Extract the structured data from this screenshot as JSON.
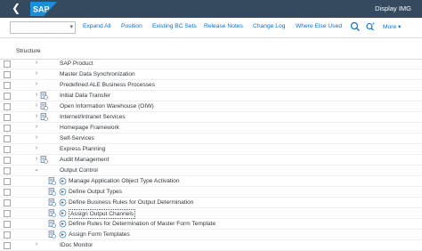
{
  "shell": {
    "title": "Display IMG",
    "logo_text": "SAP"
  },
  "toolbar": {
    "select_value": "",
    "buttons": [
      "Expand All",
      "Position",
      "Existing BC Sets",
      "Release Notes",
      "Change Log",
      "Where Else Used"
    ],
    "more": "More"
  },
  "structure": {
    "header": "Structure",
    "rows": [
      {
        "label": "SAP Product",
        "level": 0,
        "expanded": false,
        "icons": []
      },
      {
        "label": "Master Data Synchronization",
        "level": 0,
        "expanded": false,
        "icons": []
      },
      {
        "label": "Predefined ALE Business Processes",
        "level": 0,
        "expanded": false,
        "icons": []
      },
      {
        "label": "Initial Data Transfer",
        "level": 0,
        "expanded": false,
        "icons": [
          "doc-icon"
        ]
      },
      {
        "label": "Open Information Warehouse (OIW)",
        "level": 0,
        "expanded": false,
        "icons": [
          "doc-icon"
        ]
      },
      {
        "label": "Internet/Intranet Services",
        "level": 0,
        "expanded": false,
        "icons": [
          "doc-icon"
        ]
      },
      {
        "label": "Homepage Framework",
        "level": 0,
        "expanded": false,
        "icons": []
      },
      {
        "label": "Self-Services",
        "level": 0,
        "expanded": false,
        "icons": []
      },
      {
        "label": "Express Planning",
        "level": 0,
        "expanded": false,
        "icons": []
      },
      {
        "label": "Audit Management",
        "level": 0,
        "expanded": false,
        "icons": [
          "doc-icon"
        ]
      },
      {
        "label": "Output Control",
        "level": 0,
        "expanded": true,
        "icons": []
      },
      {
        "label": "Manage Application Object Type Activation",
        "level": 1,
        "leaf": true,
        "icons": [
          "doc-icon",
          "execute-icon"
        ]
      },
      {
        "label": "Define Output Types",
        "level": 1,
        "leaf": true,
        "icons": [
          "doc-icon",
          "execute-icon"
        ]
      },
      {
        "label": "Define Business Rules for Output Determination",
        "level": 1,
        "leaf": true,
        "icons": [
          "doc-icon",
          "execute-icon"
        ]
      },
      {
        "label": "Assign Output Channels",
        "level": 1,
        "leaf": true,
        "selected": true,
        "icons": [
          "doc-icon",
          "execute-icon"
        ]
      },
      {
        "label": "Define Rules for Determination of Master Form Template",
        "level": 1,
        "leaf": true,
        "icons": [
          "doc-icon",
          "execute-icon"
        ]
      },
      {
        "label": "Assign Form Templates",
        "level": 1,
        "leaf": true,
        "icons": [
          "doc-icon",
          "execute-icon"
        ]
      },
      {
        "label": "IDoc Monitor",
        "level": 0,
        "expanded": false,
        "icons": []
      }
    ]
  },
  "colors": {
    "shell": "#354a5f",
    "link": "#0a6ed1",
    "sap_blue": "#0a6ed1"
  }
}
